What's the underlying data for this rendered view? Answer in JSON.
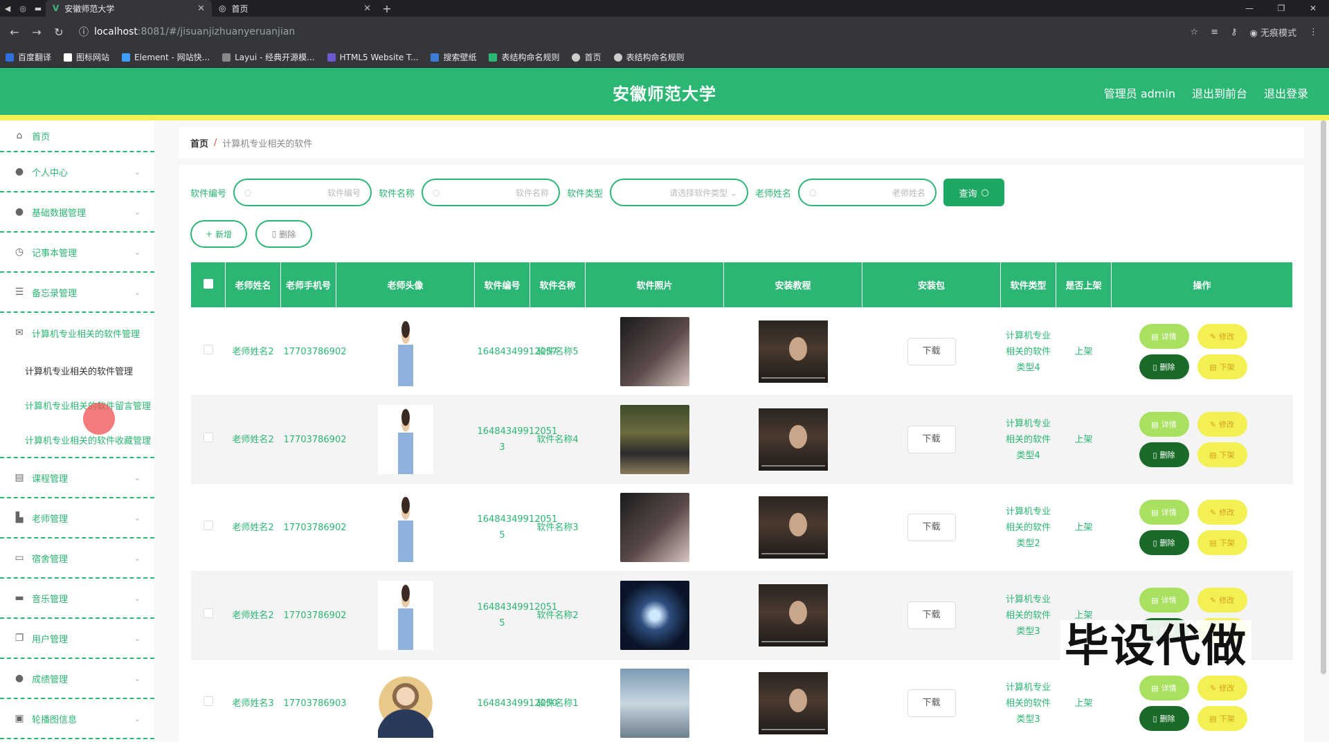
{
  "browser": {
    "tabs": [
      {
        "title": "安徽师范大学",
        "active": true
      },
      {
        "title": "首页",
        "active": false
      }
    ],
    "url_host": "localhost",
    "url_path": ":8081/#/jisuanjizhuanyeruanjian",
    "incognito_label": "无痕模式",
    "bookmarks": [
      "百度翻译",
      "图标网站",
      "Element - 网站快...",
      "Layui - 经典开源模...",
      "HTML5 Website T...",
      "搜索壁纸",
      "表结构命名规则",
      "首页",
      "表结构命名规则"
    ]
  },
  "header": {
    "title": "安徽师范大学",
    "user": "管理员 admin",
    "to_front": "退出到前台",
    "logout": "退出登录"
  },
  "sidebar": {
    "home": "首页",
    "items": [
      {
        "label": "个人中心",
        "icon": "user-icon"
      },
      {
        "label": "基础数据管理",
        "icon": "user-icon"
      },
      {
        "label": "记事本管理",
        "icon": "clock-icon"
      },
      {
        "label": "备忘录管理",
        "icon": "sliders-icon"
      },
      {
        "label": "计算机专业相关的软件管理",
        "icon": "mail-icon"
      },
      {
        "label": "课程管理",
        "icon": "briefcase-icon"
      },
      {
        "label": "老师管理",
        "icon": "teacher-icon"
      },
      {
        "label": "宿舍管理",
        "icon": "monitor-icon"
      },
      {
        "label": "音乐管理",
        "icon": "printer-icon"
      },
      {
        "label": "用户管理",
        "icon": "copy-icon"
      },
      {
        "label": "成绩管理",
        "icon": "user-icon"
      },
      {
        "label": "轮播图信息",
        "icon": "image-icon"
      }
    ],
    "subitems": [
      "计算机专业相关的软件管理",
      "计算机专业相关的软件留言管理",
      "计算机专业相关的软件收藏管理"
    ]
  },
  "breadcrumb": {
    "home": "首页",
    "current": "计算机专业相关的软件"
  },
  "search": {
    "label_code": "软件编号",
    "ph_code": "软件编号",
    "label_name": "软件名称",
    "ph_name": "软件名称",
    "label_type": "软件类型",
    "ph_type": "请选择软件类型",
    "label_teacher": "老师姓名",
    "ph_teacher": "老师姓名",
    "query": "查询"
  },
  "actions": {
    "add": "新增",
    "delete": "删除"
  },
  "table": {
    "headers": [
      "老师姓名",
      "老师手机号",
      "老师头像",
      "软件编号",
      "软件名称",
      "软件照片",
      "安装教程",
      "安装包",
      "软件类型",
      "是否上架",
      "操作"
    ],
    "rows": [
      {
        "teacher": "老师姓名2",
        "phone": "17703786902",
        "code": "16484349912057",
        "name": "软件名称5",
        "download": "下载",
        "type": "计算机专业相关的软件类型4",
        "status": "上架"
      },
      {
        "teacher": "老师姓名2",
        "phone": "17703786902",
        "code": "16484349912051 3",
        "name": "软件名称4",
        "download": "下载",
        "type": "计算机专业相关的软件类型4",
        "status": "上架"
      },
      {
        "teacher": "老师姓名2",
        "phone": "17703786902",
        "code": "16484349912051 5",
        "name": "软件名称3",
        "download": "下载",
        "type": "计算机专业相关的软件类型2",
        "status": "上架"
      },
      {
        "teacher": "老师姓名2",
        "phone": "17703786902",
        "code": "16484349912051 5",
        "name": "软件名称2",
        "download": "下载",
        "type": "计算机专业相关的软件类型3",
        "status": "上架"
      },
      {
        "teacher": "老师姓名3",
        "phone": "17703786903",
        "code": "16484349912050",
        "name": "软件名称1",
        "download": "下载",
        "type": "计算机专业相关的软件类型3",
        "status": "上架"
      }
    ],
    "op_detail": "详情",
    "op_edit": "修改",
    "op_delete": "删除",
    "op_down": "下架"
  },
  "watermark": "毕设代做",
  "colors": {
    "primary": "#2bb673",
    "accent_yellow": "#f2f052",
    "dark_green": "#1a6b2a"
  }
}
